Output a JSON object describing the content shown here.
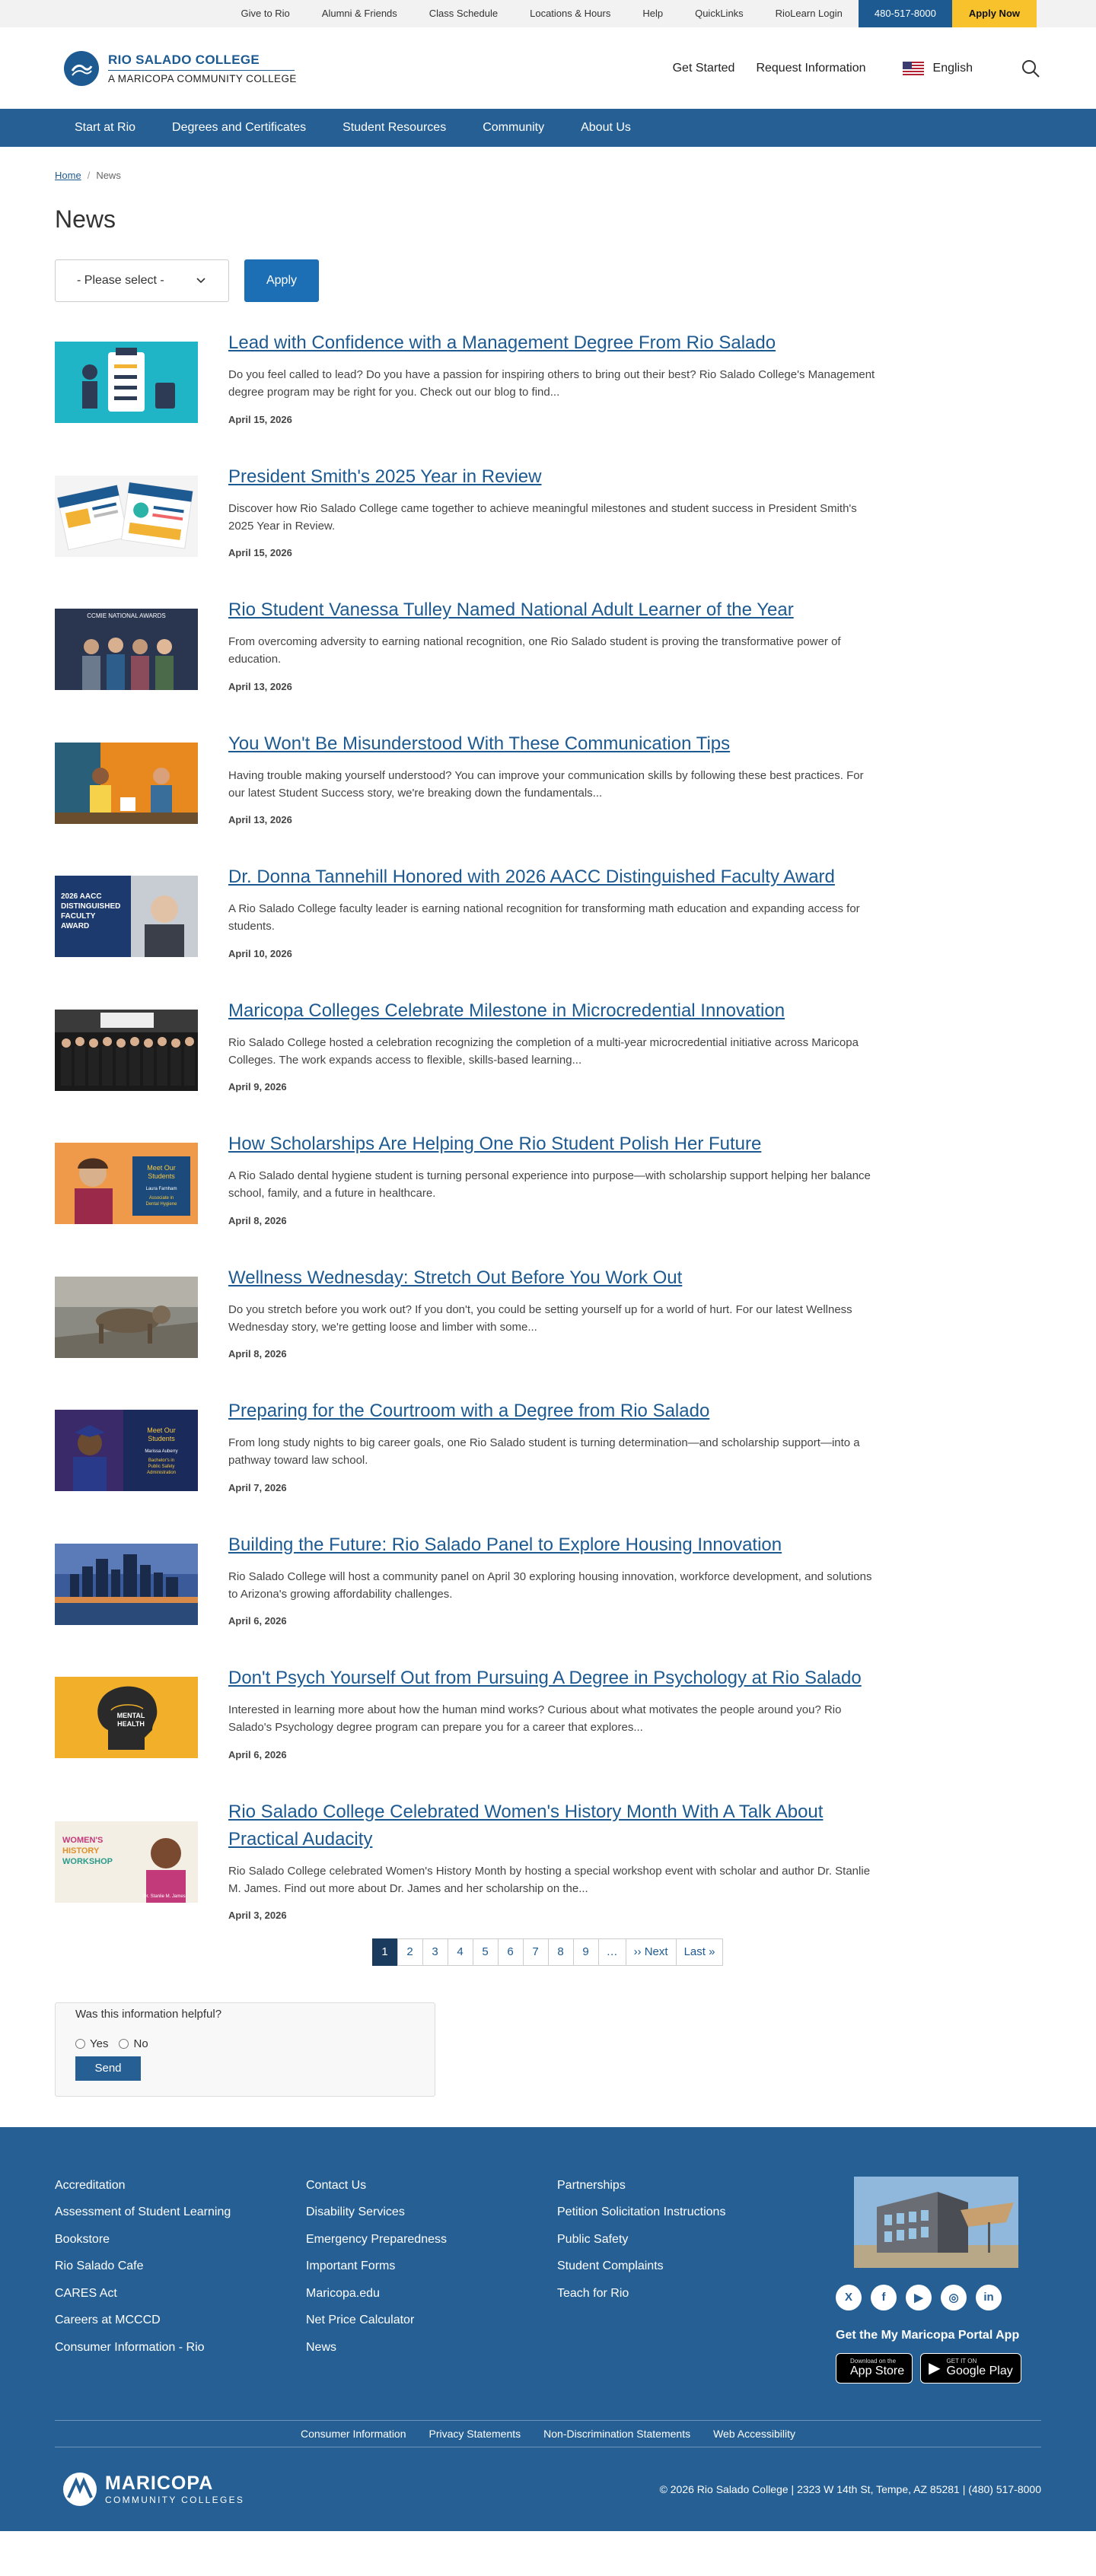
{
  "utility": {
    "links": [
      "Give to Rio",
      "Alumni & Friends",
      "Class Schedule",
      "Locations & Hours",
      "Help",
      "QuickLinks",
      "RioLearn Login"
    ],
    "phone": "480-517-8000",
    "apply": "Apply Now"
  },
  "header": {
    "logo_line1": "RIO SALADO COLLEGE",
    "logo_line2": "A MARICOPA COMMUNITY COLLEGE",
    "get_started": "Get Started",
    "request_info": "Request Information",
    "language": "English"
  },
  "nav": [
    "Start at Rio",
    "Degrees and Certificates",
    "Student Resources",
    "Community",
    "About Us"
  ],
  "breadcrumb": {
    "home": "Home",
    "current": "News"
  },
  "page_title": "News",
  "filter": {
    "select_value": "- Please select -",
    "apply_label": "Apply"
  },
  "news": [
    {
      "title": "Lead with Confidence with a Management Degree From Rio Salado",
      "summary": "Do you feel called to lead? Do you have a passion for inspiring others to bring out their best? Rio Salado College's Management degree program may be right for you. Check out our blog to find...",
      "date": "April 15, 2026"
    },
    {
      "title": "President Smith's 2025 Year in Review",
      "summary": "Discover how Rio Salado College came together to achieve meaningful milestones and student success in President Smith's 2025 Year in Review.",
      "date": "April 15, 2026"
    },
    {
      "title": "Rio Student Vanessa Tulley Named National Adult Learner of the Year",
      "summary": "From overcoming adversity to earning national recognition, one Rio Salado student is proving the transformative power of education.",
      "date": "April 13, 2026"
    },
    {
      "title": "You Won't Be Misunderstood With These Communication Tips",
      "summary": "Having trouble making yourself understood? You can improve your communication skills by following these best practices. For our latest Student Success story, we're breaking down the fundamentals...",
      "date": "April 13, 2026"
    },
    {
      "title": "Dr. Donna Tannehill Honored with 2026 AACC Distinguished Faculty Award",
      "summary": "A Rio Salado College faculty leader is earning national recognition for transforming math education and expanding access for students.",
      "date": "April 10, 2026"
    },
    {
      "title": "Maricopa Colleges Celebrate Milestone in Microcredential Innovation",
      "summary": "Rio Salado College hosted a celebration recognizing the completion of a multi-year microcredential initiative across Maricopa Colleges. The work expands access to flexible, skills-based learning...",
      "date": "April 9, 2026"
    },
    {
      "title": "How Scholarships Are Helping One Rio Student Polish Her Future",
      "summary": "A Rio Salado dental hygiene student is turning personal experience into purpose—with scholarship support helping her balance school, family, and a future in healthcare.",
      "date": "April 8, 2026"
    },
    {
      "title": "Wellness Wednesday: Stretch Out Before You Work Out",
      "summary": "Do you stretch before you work out? If you don't, you could be setting yourself up for a world of hurt. For our latest Wellness Wednesday story, we're getting loose and limber with some...",
      "date": "April 8, 2026"
    },
    {
      "title": "Preparing for the Courtroom with a Degree from Rio Salado",
      "summary": "From long study nights to big career goals, one Rio Salado student is turning determination—and scholarship support—into a pathway toward law school.",
      "date": "April 7, 2026"
    },
    {
      "title": "Building the Future: Rio Salado Panel to Explore Housing Innovation",
      "summary": "Rio Salado College will host a community panel on April 30 exploring housing innovation, workforce development, and solutions to Arizona's growing affordability challenges.",
      "date": "April 6, 2026"
    },
    {
      "title": "Don't Psych Yourself Out from Pursuing A Degree in Psychology at Rio Salado",
      "summary": "Interested in learning more about how the human mind works? Curious about what motivates the people around you? Rio Salado's Psychology degree program can prepare you for a career that explores...",
      "date": "April 6, 2026"
    },
    {
      "title": "Rio Salado College Celebrated Women's History Month With A Talk About Practical Audacity",
      "summary": "Rio Salado College celebrated Women's History Month by hosting a special workshop event with scholar and author Dr. Stanlie M. James. Find out more about Dr. James and her scholarship on the...",
      "date": "April 3, 2026"
    }
  ],
  "thumbs": {
    "t3": "CCMIE NATIONAL AWARDS",
    "t5": [
      "2026 AACC",
      "DISTINGUISHED",
      "FACULTY",
      "AWARD"
    ],
    "t7": [
      "Meet Our",
      "Students",
      "Laura Farnham",
      "Associate in",
      "Dental Hygiene"
    ],
    "t9": [
      "Meet Our",
      "Students",
      "Marissa Auberry",
      "Bachelor's in",
      "Public Safety",
      "Administration"
    ],
    "t11": [
      "MENTAL",
      "HEALTH"
    ],
    "t12": [
      "WOMEN'S",
      "HISTORY",
      "WORKSHOP",
      "Dr. Stanlie M. James"
    ]
  },
  "pager": {
    "pages": [
      "1",
      "2",
      "3",
      "4",
      "5",
      "6",
      "7",
      "8",
      "9",
      "…"
    ],
    "next": "›› Next",
    "last": "Last »",
    "active": "1"
  },
  "feedback": {
    "question": "Was this information helpful?",
    "yes": "Yes",
    "no": "No",
    "send": "Send"
  },
  "footer": {
    "col1": [
      "Accreditation",
      "Assessment of Student Learning",
      "Bookstore",
      "Rio Salado Cafe",
      "CARES Act",
      "Careers at MCCCD",
      "Consumer Information - Rio"
    ],
    "col2": [
      "Contact Us",
      "Disability Services",
      "Emergency Preparedness",
      "Important Forms",
      "Maricopa.edu",
      "Net Price Calculator",
      "News"
    ],
    "col3": [
      "Partnerships",
      "Petition Solicitation Instructions",
      "Public Safety",
      "Student Complaints",
      "Teach for Rio"
    ],
    "social_glyphs": [
      "X",
      "f",
      "▶",
      "◎",
      "in"
    ],
    "app_title": "Get the My Maricopa Portal App",
    "appstore_small": "Download on the",
    "appstore_big": "App Store",
    "googleplay_small": "GET IT ON",
    "googleplay_big": "Google Play",
    "bottom_links": [
      "Consumer Information",
      "Privacy Statements",
      "Non-Discrimination Statements",
      "Web Accessibility"
    ],
    "logo_line1": "MARICOPA",
    "logo_line2": "COMMUNITY COLLEGES",
    "address": "© 2026 Rio Salado College | 2323 W 14th St, Tempe, AZ 85281 | (480) 517-8000"
  },
  "colors": {
    "brand_blue": "#255f94",
    "link_blue": "#1d5a91",
    "apply_yellow": "#f7c22b",
    "button_blue": "#1d6fb5"
  }
}
